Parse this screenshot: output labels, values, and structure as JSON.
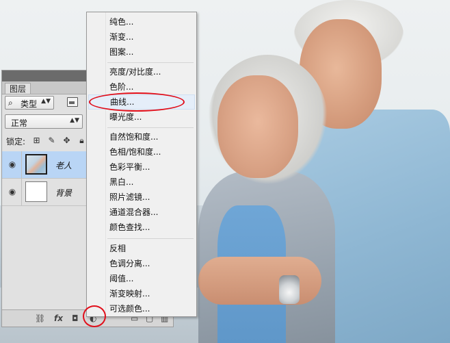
{
  "photo": {
    "subject": ""
  },
  "layers_panel": {
    "tab_label": "图层",
    "filter": {
      "icon": "search-icon",
      "label": "类型",
      "arrow": "▲▼"
    },
    "blend_mode": {
      "value": "正常",
      "arrow": "▲▼"
    },
    "lock_label": "锁定:",
    "layers": [
      {
        "name": "老人",
        "selected": true,
        "visible": true
      },
      {
        "name": "背景",
        "selected": false,
        "visible": true
      }
    ],
    "bottom_icons": [
      "link-icon",
      "fx-icon",
      "mask-icon",
      "adjustment-icon",
      "folder-icon",
      "new-layer-icon",
      "trash-icon"
    ],
    "fx_label": "fx"
  },
  "adjustment_menu": {
    "group1": [
      "纯色...",
      "渐变...",
      "图案..."
    ],
    "group2": [
      "亮度/对比度...",
      "色阶...",
      "曲线...",
      "曝光度..."
    ],
    "group3": [
      "自然饱和度...",
      "色相/饱和度...",
      "色彩平衡...",
      "黑白...",
      "照片滤镜...",
      "通道混合器...",
      "颜色查找..."
    ],
    "group4": [
      "反相",
      "色调分离...",
      "阈值...",
      "渐变映射...",
      "可选颜色..."
    ],
    "highlighted": "曲线..."
  },
  "annotation_color": "#e10e1a"
}
